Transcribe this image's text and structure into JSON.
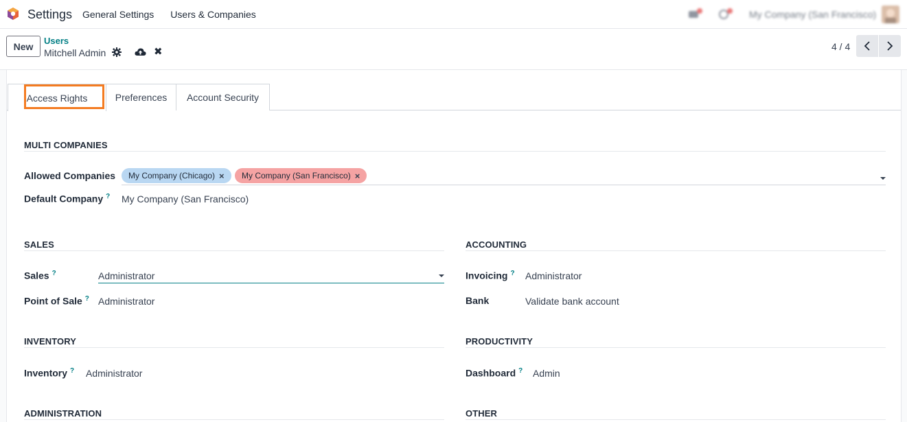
{
  "navbar": {
    "app_title": "Settings",
    "menu": [
      "General Settings",
      "Users & Companies"
    ],
    "company": "My Company (San Francisco)"
  },
  "control": {
    "new_label": "New",
    "breadcrumb": "Users",
    "record_name": "Mitchell Admin",
    "discard_symbol": "✖",
    "pager": "4 / 4"
  },
  "tabs": [
    "Access Rights",
    "Preferences",
    "Account Security"
  ],
  "multi_companies": {
    "title": "MULTI COMPANIES",
    "allowed_label": "Allowed Companies",
    "allowed_tags": [
      "My Company (Chicago)",
      "My Company (San Francisco)"
    ],
    "default_label": "Default Company",
    "default_value": "My Company (San Francisco)"
  },
  "sales": {
    "title": "SALES",
    "sales_label": "Sales",
    "sales_value": "Administrator",
    "pos_label": "Point of Sale",
    "pos_value": "Administrator"
  },
  "accounting": {
    "title": "ACCOUNTING",
    "invoicing_label": "Invoicing",
    "invoicing_value": "Administrator",
    "bank_label": "Bank",
    "bank_value": "Validate bank account"
  },
  "inventory": {
    "title": "INVENTORY",
    "inventory_label": "Inventory",
    "inventory_value": "Administrator"
  },
  "productivity": {
    "title": "PRODUCTIVITY",
    "dashboard_label": "Dashboard",
    "dashboard_value": "Admin"
  },
  "administration": {
    "title": "ADMINISTRATION"
  },
  "other": {
    "title": "OTHER"
  },
  "help_mark": "?",
  "tag_remove": "×",
  "colors": {
    "accent": "#017e84",
    "highlight": "#f47b20",
    "tag_blue": "#b9d7f2",
    "tag_red": "#f5a3a3"
  }
}
